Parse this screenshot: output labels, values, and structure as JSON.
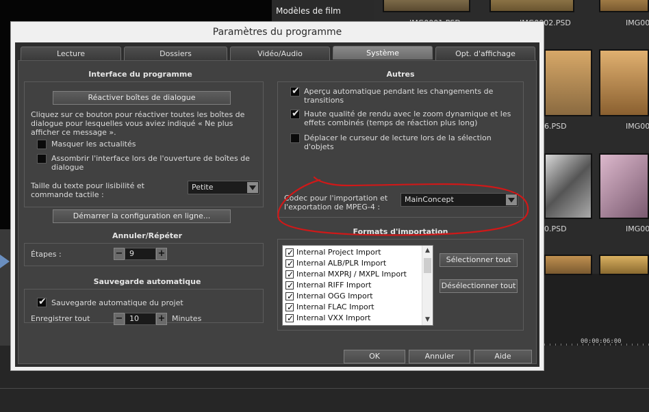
{
  "background": {
    "header_label": "Modèles de film",
    "thumbnails": [
      {
        "label": "IMG0001.PSD"
      },
      {
        "label": "IMG0002.PSD"
      },
      {
        "label": "IMG000"
      },
      {
        "label": "6.PSD"
      },
      {
        "label": "IMG000"
      },
      {
        "label": "0.PSD"
      },
      {
        "label": "IMG000"
      }
    ],
    "timecode": "00:00:06:00"
  },
  "dialog": {
    "title": "Paramètres du programme",
    "close_icon": "✕",
    "tabs": [
      {
        "label": "Lecture"
      },
      {
        "label": "Dossiers"
      },
      {
        "label": "Vidéo/Audio"
      },
      {
        "label": "Système",
        "active": true
      },
      {
        "label": "Opt. d'affichage"
      }
    ],
    "interface": {
      "title": "Interface du programme",
      "reactivate_button": "Réactiver boîtes de dialogue",
      "reactivate_desc": "Cliquez sur ce bouton pour réactiver toutes les boîtes de dialogue pour lesquelles vous aviez indiqué « Ne plus afficher ce message ».",
      "hide_news_label": "Masquer les actualités",
      "hide_news_checked": false,
      "darken_label": "Assombrir l'interface lors de l'ouverture de boîtes de dialogue",
      "darken_checked": false,
      "text_size_label": "Taille du texte pour lisibilité et commande tactile :",
      "text_size_value": "Petite",
      "online_config_button": "Démarrer la configuration en ligne..."
    },
    "undo": {
      "title": "Annuler/Répéter",
      "steps_label": "Étapes :",
      "steps_value": "9",
      "minus": "−",
      "plus": "+"
    },
    "autosave": {
      "title": "Sauvegarde automatique",
      "autosave_label": "Sauvegarde automatique du projet",
      "autosave_checked": true,
      "save_every_label": "Enregistrer tout",
      "save_every_value": "10",
      "minutes_label": "Minutes",
      "minus": "−",
      "plus": "+"
    },
    "others": {
      "title": "Autres",
      "options": [
        {
          "label": "Aperçu automatique pendant les changements de transitions",
          "checked": true
        },
        {
          "label": "Haute qualité de rendu avec le zoom dynamique et les effets combinés (temps de réaction plus long)",
          "checked": true
        },
        {
          "label": "Déplacer le curseur de lecture lors de la sélection d'objets",
          "checked": false
        }
      ],
      "codec_label": "Codec pour l'importation et l'exportation de MPEG-4 :",
      "codec_value": "MainConcept",
      "annotation_color": "#d01818"
    },
    "import_formats": {
      "title": "Formats d'importation",
      "items": [
        {
          "label": "Internal Project Import",
          "checked": true
        },
        {
          "label": "Internal ALB/PLR Import",
          "checked": true
        },
        {
          "label": "Internal MXPRJ / MXPL Import",
          "checked": true
        },
        {
          "label": "Internal RIFF Import",
          "checked": true
        },
        {
          "label": "Internal OGG Import",
          "checked": true
        },
        {
          "label": "Internal FLAC Import",
          "checked": true
        },
        {
          "label": "Internal VXX Import",
          "checked": true
        }
      ],
      "select_all_button": "Sélectionner tout",
      "deselect_all_button": "Désélectionner tout",
      "scroll_up_icon": "▲",
      "scroll_down_icon": "▼"
    },
    "footer": {
      "ok": "OK",
      "cancel": "Annuler",
      "help": "Aide"
    }
  }
}
